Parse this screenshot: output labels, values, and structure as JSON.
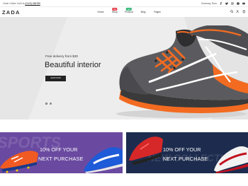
{
  "topbar": {
    "promo_text": "Order Online Call Us",
    "phone": "(0123) 456789",
    "currency": "Currency: Euro",
    "social_icons": [
      "facebook-icon",
      "twitter-icon",
      "instagram-icon",
      "pinterest-icon",
      "youtube-icon"
    ]
  },
  "header": {
    "logo": "ZADA",
    "nav": [
      {
        "label": "Home",
        "badge": ""
      },
      {
        "label": "Shop",
        "badge": "Hot",
        "badge_color": "#e63946"
      },
      {
        "label": "Product",
        "badge": "New",
        "badge_color": "#2bb673"
      },
      {
        "label": "Blog",
        "badge": ""
      },
      {
        "label": "Pages",
        "badge": ""
      }
    ],
    "icons": [
      "search-icon",
      "user-icon",
      "cart-icon"
    ]
  },
  "hero": {
    "subtitle": "Free delivery from $30",
    "title": "Beautiful interior",
    "button_label": "SHOP NOW",
    "background": "#ededed",
    "accent": "#f26b21",
    "slides": 2,
    "active_slide": 1
  },
  "banners": [
    {
      "ghost_text": "SPORTS",
      "offer": "10% OFF YOUR",
      "subtitle": "NEXT PURCHASE",
      "background": "#6a4aa0"
    },
    {
      "ghost_text": "NEW COLLECTION",
      "offer": "10% OFF YOUR",
      "subtitle": "NEXT PURCHASE",
      "background": "#1d2c4e"
    }
  ]
}
